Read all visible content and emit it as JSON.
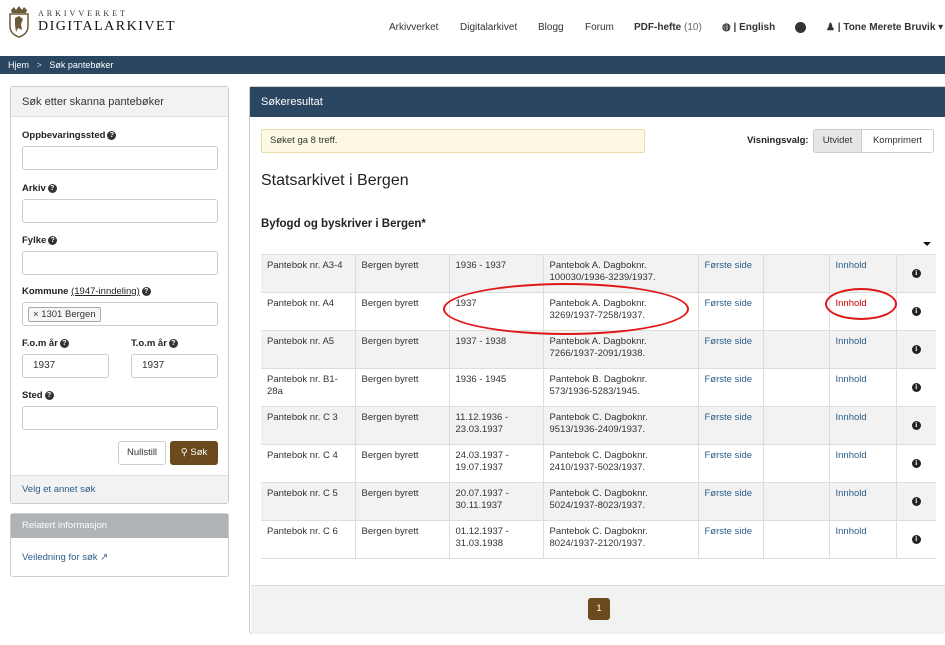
{
  "header": {
    "logo_top": "ARKIVVERKET",
    "logo_bottom": "DIGITALARKIVET",
    "nav": [
      "Arkivverket",
      "Digitalarkivet",
      "Blogg",
      "Forum"
    ],
    "pdf_label": "PDF-hefte",
    "pdf_count": "(10)",
    "language": "| English",
    "user": "| Tone Merete Bruvik"
  },
  "breadcrumb": {
    "home": "Hjem",
    "separator": ">",
    "current": "Søk pantebøker"
  },
  "search": {
    "title": "Søk etter skanna pantebøker",
    "storage_label": "Oppbevaringssted",
    "archive_label": "Arkiv",
    "county_label": "Fylke",
    "municipality_label": "Kommune",
    "municipality_note": "(1947-inndeling)",
    "municipality_tag": "1301 Bergen",
    "from_year_label": "F.o.m år",
    "to_year_label": "T.o.m år",
    "from_year": "1937",
    "to_year": "1937",
    "place_label": "Sted",
    "reset_label": "Nullstill",
    "search_label": "Søk",
    "other_search": "Velg et annet søk"
  },
  "related": {
    "title": "Relatert informasjon",
    "link": "Veiledning for søk"
  },
  "results": {
    "title": "Søkeresultat",
    "count_text": "Søket ga 8 treff.",
    "view_label": "Visningsvalg:",
    "view_expanded": "Utvidet",
    "view_compact": "Komprimert",
    "archive_heading": "Statsarkivet i Bergen",
    "sub_heading": "Byfogd og byskriver i Bergen*",
    "page": "1",
    "rows": [
      {
        "name": "Pantebok nr. A3-4",
        "court": "Bergen byrett",
        "period": "1936 - 1937",
        "desc": "Pantebok A. Dagboknr. 100030/1936-3239/1937.",
        "first": "Første side",
        "content": "Innhold"
      },
      {
        "name": "Pantebok nr. A4",
        "court": "Bergen byrett",
        "period": "1937",
        "desc": "Pantebok A. Dagboknr. 3269/1937-7258/1937.",
        "first": "Første side",
        "content": "Innhold"
      },
      {
        "name": "Pantebok nr. A5",
        "court": "Bergen byrett",
        "period": "1937 - 1938",
        "desc": "Pantebok A. Dagboknr. 7266/1937-2091/1938.",
        "first": "Første side",
        "content": "Innhold"
      },
      {
        "name": "Pantebok nr. B1-28a",
        "court": "Bergen byrett",
        "period": "1936 - 1945",
        "desc": "Pantebok B. Dagboknr. 573/1936-5283/1945.",
        "first": "Første side",
        "content": "Innhold"
      },
      {
        "name": "Pantebok nr. C 3",
        "court": "Bergen byrett",
        "period": "11.12.1936 - 23.03.1937",
        "desc": "Pantebok C. Dagboknr. 9513/1936-2409/1937.",
        "first": "Første side",
        "content": "Innhold"
      },
      {
        "name": "Pantebok nr. C 4",
        "court": "Bergen byrett",
        "period": "24.03.1937 - 19.07.1937",
        "desc": "Pantebok C. Dagboknr. 2410/1937-5023/1937.",
        "first": "Første side",
        "content": "Innhold"
      },
      {
        "name": "Pantebok nr. C 5",
        "court": "Bergen byrett",
        "period": "20.07.1937 - 30.11.1937",
        "desc": "Pantebok C. Dagboknr. 5024/1937-8023/1937.",
        "first": "Første side",
        "content": "Innhold"
      },
      {
        "name": "Pantebok nr. C 6",
        "court": "Bergen byrett",
        "period": "01.12.1937 - 31.03.1938",
        "desc": "Pantebok C. Dagboknr. 8024/1937-2120/1937.",
        "first": "Første side",
        "content": "Innhold"
      }
    ]
  },
  "colors": {
    "navy": "#2a4661",
    "brown": "#6b4b1e",
    "link": "#2a5d8a",
    "highlight": "#e01616"
  }
}
